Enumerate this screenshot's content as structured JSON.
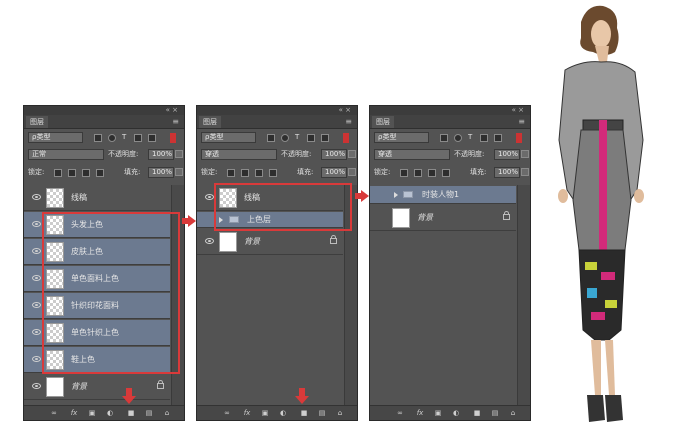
{
  "panel1": {
    "tab": "图层",
    "kind": "ρ类型",
    "blend": "正常",
    "opacity_label": "不透明度:",
    "opacity": "100%",
    "lock_label": "锁定:",
    "fill_label": "填充:",
    "fill": "100%",
    "layers": [
      "线稿",
      "头发上色",
      "皮肤上色",
      "单色面料上色",
      "针织印花面料",
      "单色针织上色",
      "鞋上色",
      "背景"
    ]
  },
  "panel2": {
    "tab": "图层",
    "kind": "ρ类型",
    "blend": "穿透",
    "opacity_label": "不透明度:",
    "opacity": "100%",
    "lock_label": "锁定:",
    "fill_label": "填充:",
    "fill": "100%",
    "layers": [
      "线稿",
      "上色层",
      "背景"
    ]
  },
  "panel3": {
    "tab": "图层",
    "kind": "ρ类型",
    "blend": "穿透",
    "opacity_label": "不透明度:",
    "opacity": "100%",
    "lock_label": "锁定:",
    "fill_label": "填充:",
    "fill": "100%",
    "layers": [
      "时装人物1",
      "背景"
    ]
  },
  "colors": {
    "highlight_border": "#d93a3a",
    "selected_row": "#6c7a90",
    "panel_bg": "#535353"
  },
  "icons": {
    "visibility": "eye-icon",
    "lock": "lock-icon",
    "folder": "folder-icon",
    "link": "link-icon",
    "fx": "fx-icon",
    "mask": "mask-icon",
    "adjust": "adjustment-icon",
    "group": "group-folder-icon",
    "new": "new-layer-icon",
    "trash": "trash-icon"
  }
}
